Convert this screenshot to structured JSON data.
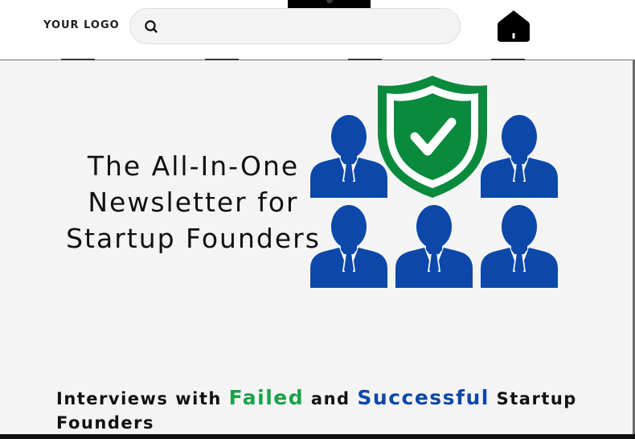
{
  "header": {
    "logo_text": "YOUR LOGO",
    "search": {
      "placeholder": "",
      "value": ""
    },
    "icons": [
      "search-icon",
      "home-icon"
    ]
  },
  "hero": {
    "title_lines": [
      "The All-In-One",
      "Newsletter for",
      "Startup Founders"
    ],
    "graphic": {
      "name": "shield-check-people-icon",
      "colors": {
        "shield": "#0a8a3c",
        "people": "#0b48a9"
      }
    }
  },
  "subheadline": {
    "prefix": "Interviews with ",
    "failed": "Failed",
    "middle": " and ",
    "successful": "Successful",
    "suffix": " Startup Founders"
  },
  "colors": {
    "accent_green": "#18a34a",
    "accent_blue": "#0b48a9",
    "background": "#f4f4f4"
  }
}
